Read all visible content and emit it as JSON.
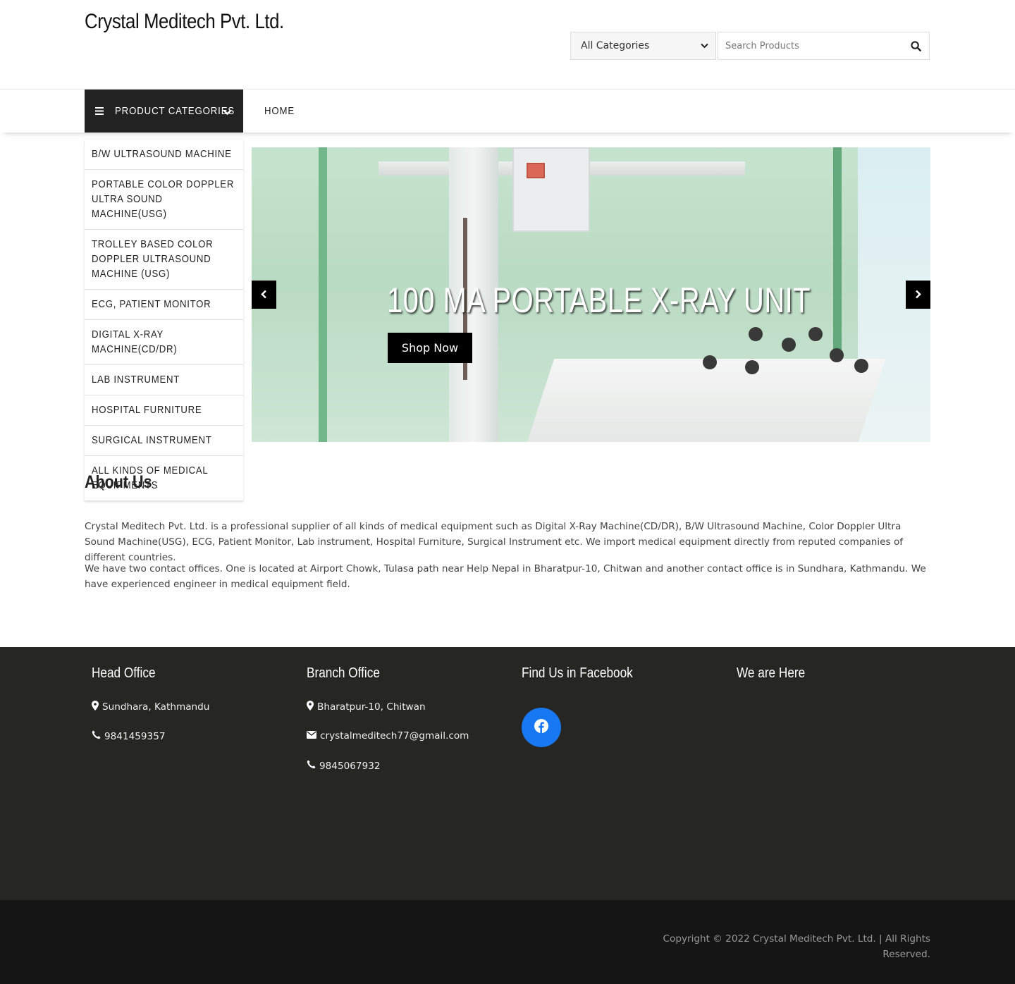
{
  "header": {
    "site_title": "Crystal Meditech Pvt. Ltd.",
    "category_select": {
      "selected": "All Categories"
    },
    "search": {
      "placeholder": "Search Products"
    }
  },
  "nav": {
    "categories_label": "Product Categories",
    "home_label": "Home"
  },
  "categories": [
    "B/W Ultrasound Machine",
    "Portable Color Doppler Ultra Sound Machine(USG)",
    "Trolley Based Color Doppler Ultrasound Machine (USG)",
    "ECG, Patient Monitor",
    "Digital X-Ray Machine(CD/DR)",
    "Lab Instrument",
    "Hospital Furniture",
    "Surgical Instrument",
    "All kinds of Medical Equipments"
  ],
  "slider": {
    "title": "100 MA PORTABLE X-RAY UNIT",
    "button_label": "Shop Now"
  },
  "about": {
    "title": "About Us",
    "paragraph1": "Crystal Meditech Pvt. Ltd. is a professional supplier of all kinds of medical equipment such as Digital X-Ray Machine(CD/DR), B/W Ultrasound Machine, Color Doppler Ultra Sound Machine(USG), ECG, Patient Monitor, Lab instrument, Hospital Furniture, Surgical Instrument etc. We import medical equipment directly from reputed companies of different countries.",
    "paragraph2": "We have two contact offices. One is located at Airport Chowk, Tulasa path near Help Nepal in Bharatpur-10, Chitwan and another contact office is in Sundhara, Kathmandu. We have experienced engineer in medical equipment field."
  },
  "footer": {
    "head_office": {
      "title": "Head Office",
      "address": "Sundhara, Kathmandu",
      "phone": "9841459357"
    },
    "branch_office": {
      "title": "Branch Office",
      "address": "Bharatpur-10, Chitwan",
      "email": "crystalmeditech77@gmail.com",
      "phone": "9845067932"
    },
    "facebook": {
      "title": "Find Us in Facebook"
    },
    "map": {
      "title": "We are Here"
    },
    "copyright": "Copyright © 2022 Crystal Meditech Pvt. Ltd. | All Rights Reserved."
  },
  "colors": {
    "nav_dark": "#222222",
    "footer_bg": "#262622",
    "bottom_bar": "#151515",
    "facebook_blue": "#1877f2"
  },
  "icons": [
    "search-icon",
    "menu-icon",
    "chevron-down-icon",
    "chevron-left-icon",
    "chevron-right-icon",
    "map-marker-icon",
    "phone-icon",
    "envelope-icon",
    "facebook-icon"
  ]
}
